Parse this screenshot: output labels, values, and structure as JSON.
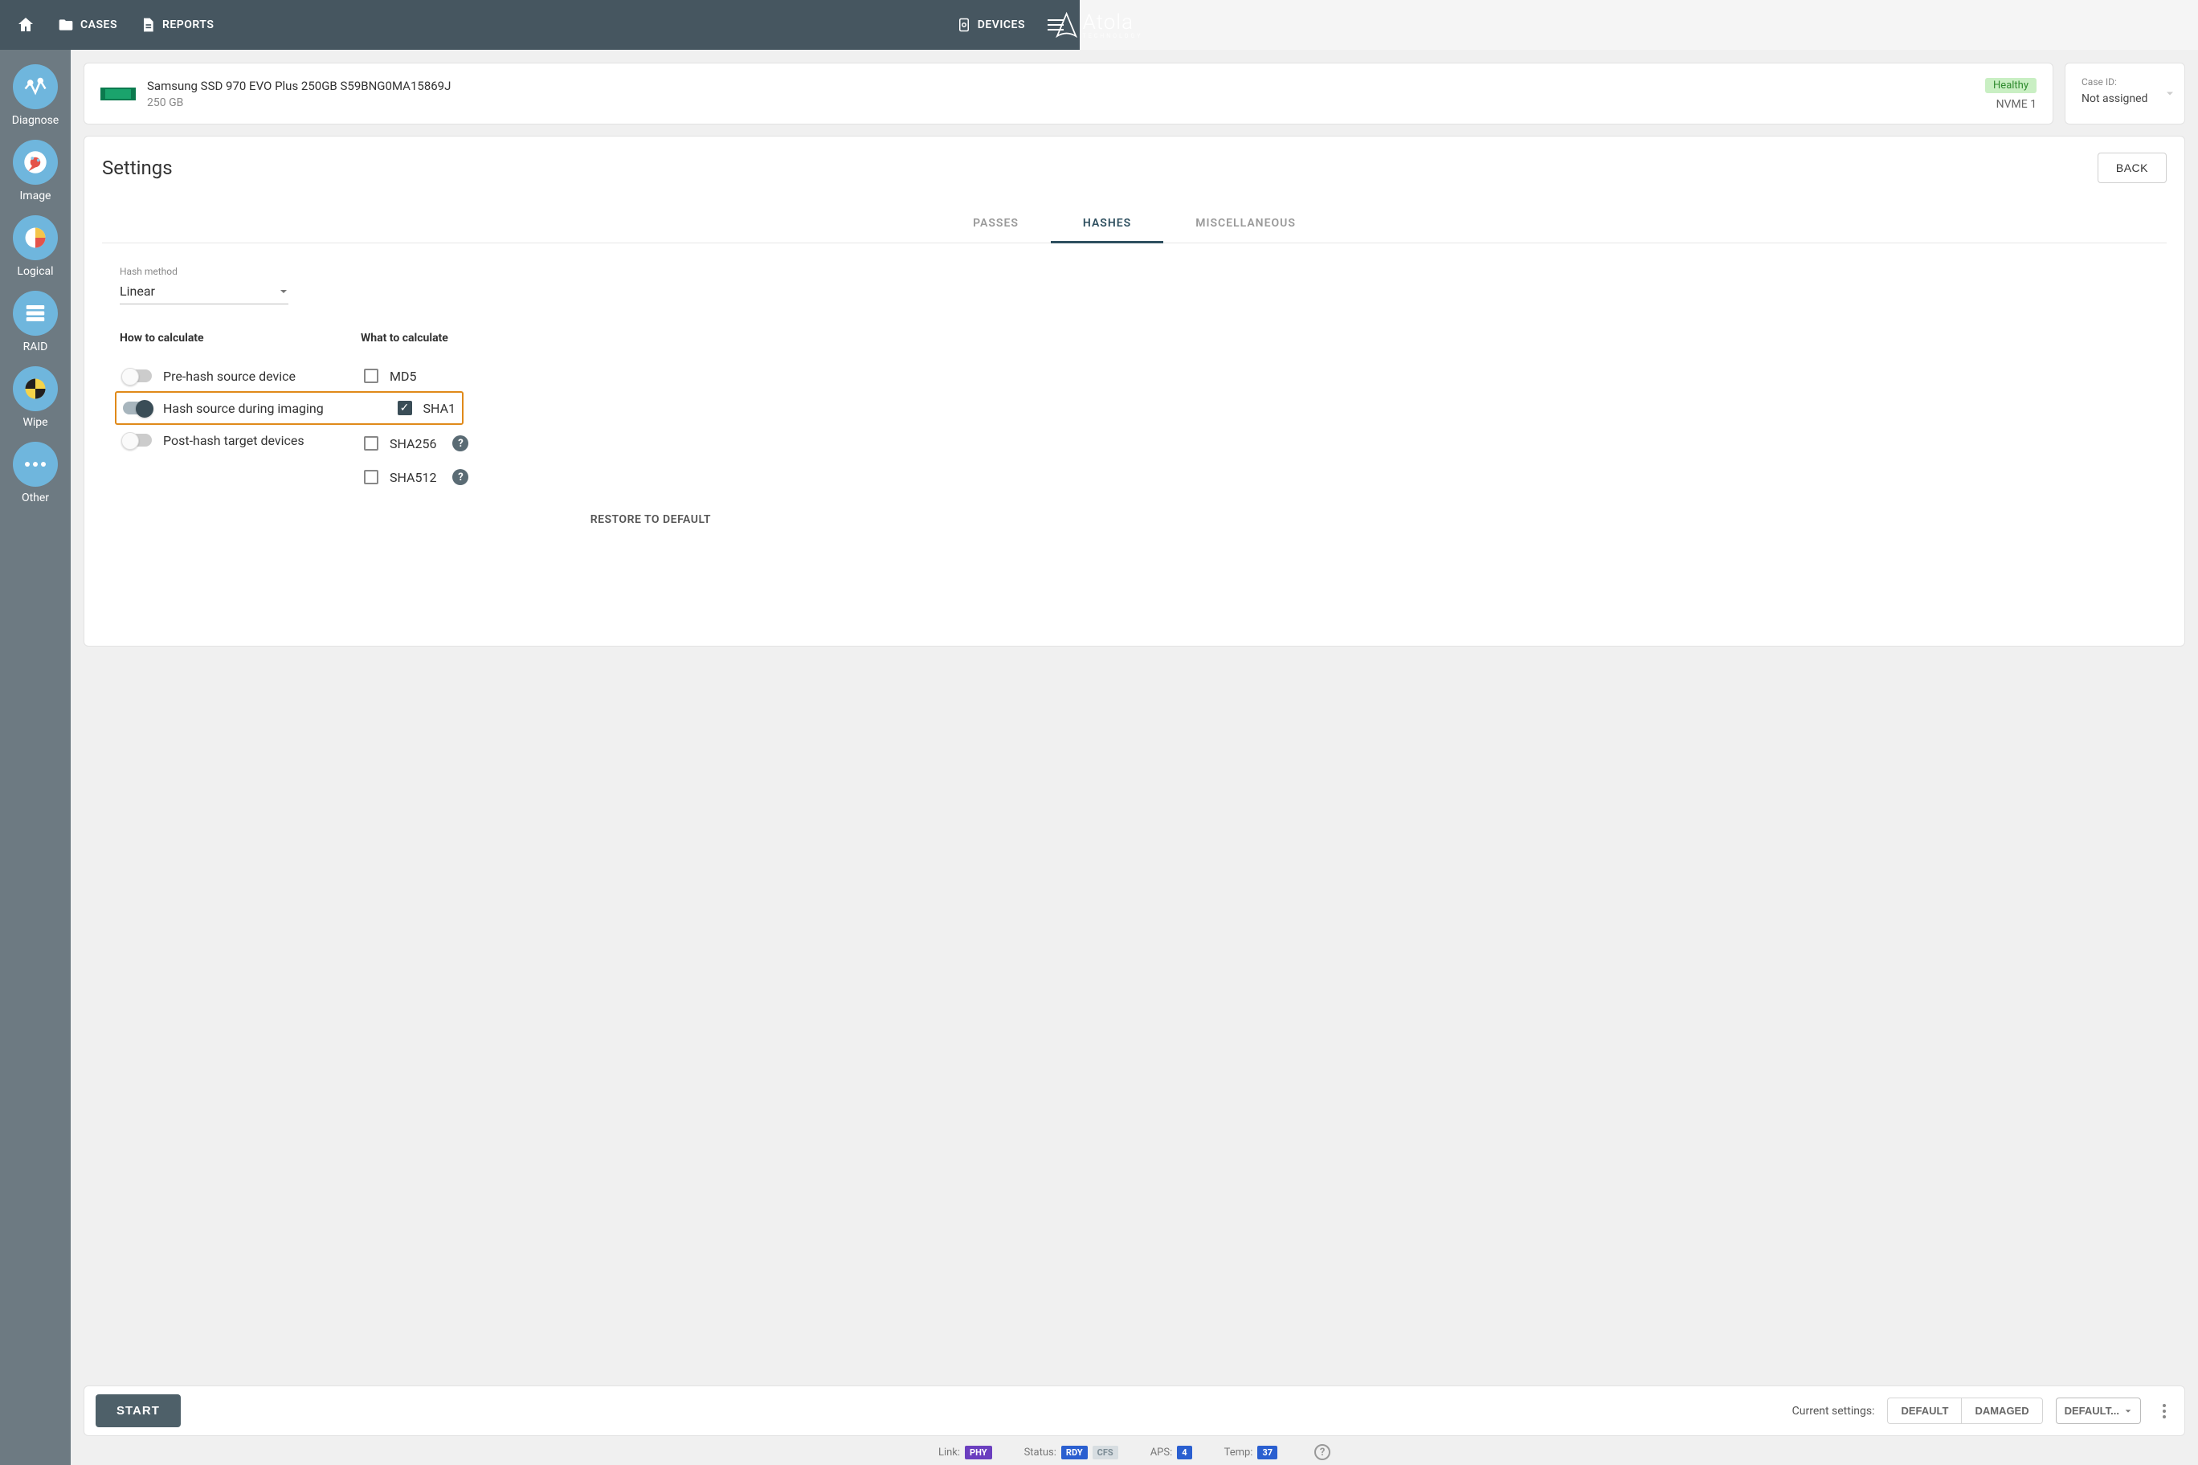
{
  "topbar": {
    "home": "HOME",
    "cases": "CASES",
    "reports": "REPORTS",
    "devices": "DEVICES",
    "brand": "Atola",
    "brand_sub": "TECHNOLOGY"
  },
  "rail": {
    "items": [
      {
        "label": "Diagnose"
      },
      {
        "label": "Image"
      },
      {
        "label": "Logical"
      },
      {
        "label": "RAID"
      },
      {
        "label": "Wipe"
      },
      {
        "label": "Other"
      }
    ]
  },
  "device": {
    "name": "Samsung SSD 970 EVO Plus 250GB S59BNG0MA15869J",
    "size": "250 GB",
    "health": "Healthy",
    "port": "NVME 1"
  },
  "case": {
    "label": "Case ID:",
    "value": "Not assigned"
  },
  "settings": {
    "title": "Settings",
    "back": "BACK",
    "tabs": {
      "passes": "PASSES",
      "hashes": "HASHES",
      "misc": "MISCELLANEOUS"
    },
    "hash_method_label": "Hash method",
    "hash_method_value": "Linear",
    "how_label": "How to calculate",
    "what_label": "What to calculate",
    "toggles": {
      "prehash": "Pre-hash source device",
      "during": "Hash source during imaging",
      "posthash": "Post-hash target devices"
    },
    "checks": {
      "md5": "MD5",
      "sha1": "SHA1",
      "sha256": "SHA256",
      "sha512": "SHA512"
    },
    "restore": "RESTORE TO DEFAULT"
  },
  "bottom": {
    "start": "START",
    "current_settings": "Current settings:",
    "default": "DEFAULT",
    "damaged": "DAMAGED",
    "default_drop": "DEFAULT..."
  },
  "status": {
    "link_label": "Link:",
    "link_val": "PHY",
    "status_label": "Status:",
    "status_v1": "RDY",
    "status_v2": "CFS",
    "aps_label": "APS:",
    "aps_val": "4",
    "temp_label": "Temp:",
    "temp_val": "37"
  }
}
